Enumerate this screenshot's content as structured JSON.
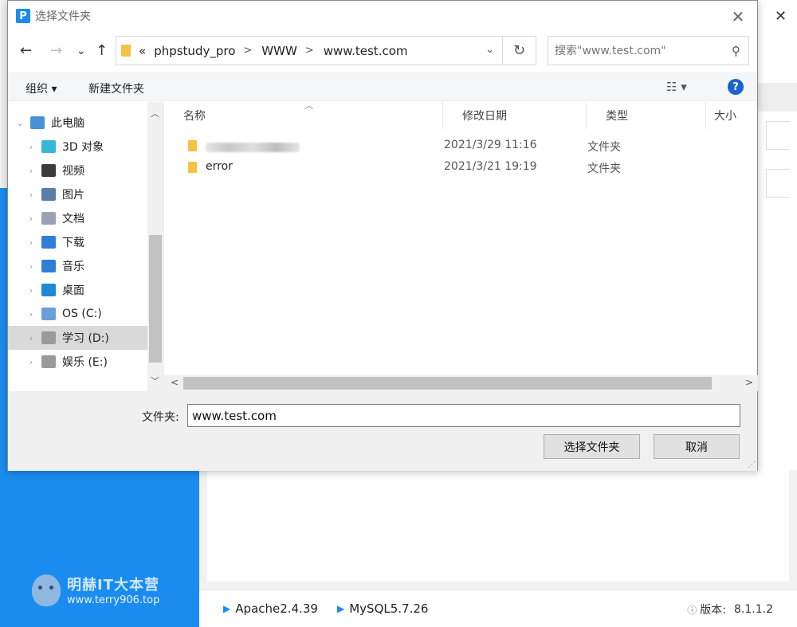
{
  "dialog": {
    "title": "选择文件夹",
    "app_icon_letter": "P",
    "close_glyph": "✕"
  },
  "nav": {
    "back": "←",
    "forward": "→",
    "recent": "⌄",
    "up": "↑",
    "breadcrumb_overflow": "«",
    "breadcrumb": [
      "phpstudy_pro",
      "WWW",
      "www.test.com"
    ],
    "refresh": "↻",
    "search_placeholder": "搜索\"www.test.com\""
  },
  "toolbar": {
    "organize": "组织 ▾",
    "new_folder": "新建文件夹",
    "view": "☷ ▾",
    "help": "?"
  },
  "tree": [
    {
      "label": "此电脑",
      "icon": "computer-icon",
      "color": "#4a90d9",
      "selected": false,
      "expanded": true
    },
    {
      "label": "3D 对象",
      "icon": "3d-objects-icon",
      "color": "#39b6d6",
      "selected": false
    },
    {
      "label": "视频",
      "icon": "video-icon",
      "color": "#3b3b3b",
      "selected": false
    },
    {
      "label": "图片",
      "icon": "pictures-icon",
      "color": "#5a7ea6",
      "selected": false
    },
    {
      "label": "文档",
      "icon": "documents-icon",
      "color": "#9aa4b0",
      "selected": false
    },
    {
      "label": "下载",
      "icon": "downloads-icon",
      "color": "#2f7fd8",
      "selected": false
    },
    {
      "label": "音乐",
      "icon": "music-icon",
      "color": "#2f7fd8",
      "selected": false
    },
    {
      "label": "桌面",
      "icon": "desktop-icon",
      "color": "#1e88d4",
      "selected": false
    },
    {
      "label": "OS (C:)",
      "icon": "windows-drive-icon",
      "color": "#6a9fd8",
      "selected": false
    },
    {
      "label": "学习 (D:)",
      "icon": "drive-icon",
      "color": "#9a9a9a",
      "selected": true
    },
    {
      "label": "娱乐 (E:)",
      "icon": "drive-icon",
      "color": "#9a9a9a",
      "selected": false
    }
  ],
  "list": {
    "columns": [
      "名称",
      "修改日期",
      "类型",
      "大小"
    ],
    "rows": [
      {
        "name": "",
        "blurred": true,
        "date": "2021/3/29 11:16",
        "type": "文件夹"
      },
      {
        "name": "error",
        "blurred": false,
        "date": "2021/3/21 19:19",
        "type": "文件夹"
      }
    ]
  },
  "bottom": {
    "folder_label": "文件夹:",
    "folder_value": "www.test.com",
    "select_button": "选择文件夹",
    "cancel_button": "取消"
  },
  "background": {
    "services": [
      "Apache2.4.39",
      "MySQL5.7.26"
    ],
    "version_label": "版本:",
    "version_value": "8.1.1.2",
    "watermark_title": "明赫IT大本营",
    "watermark_url": "www.terry906.top",
    "close_glyph": "✕",
    "accent": "#1a8cef"
  }
}
